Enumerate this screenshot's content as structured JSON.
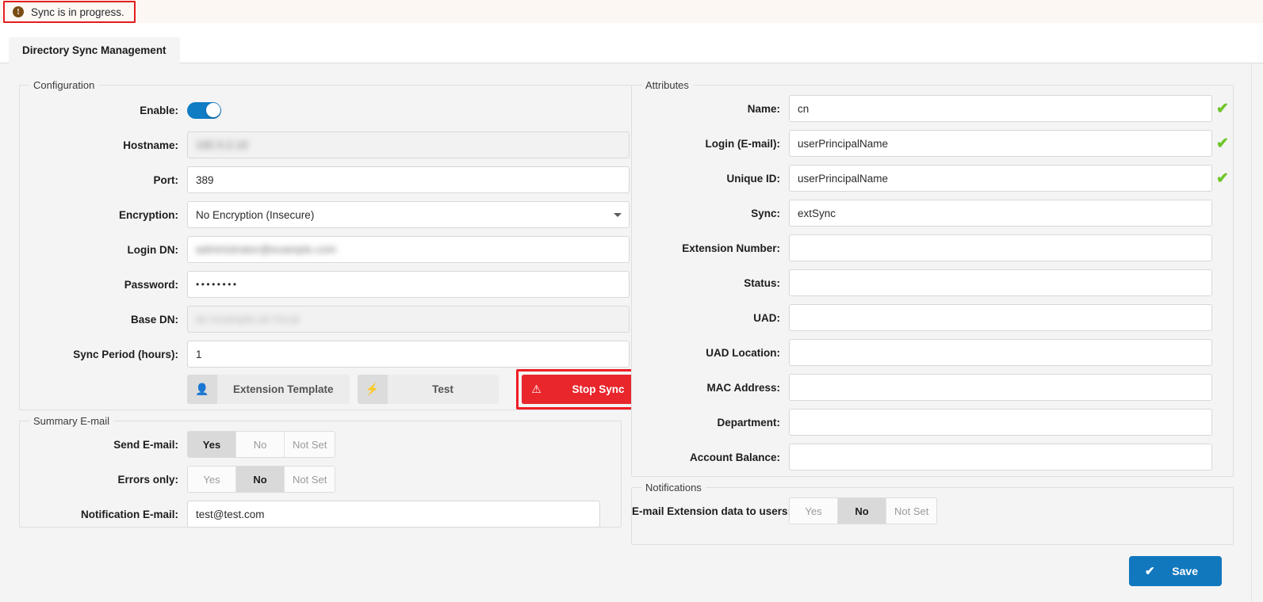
{
  "alert": {
    "icon": "exclamation-circle-icon",
    "message": "Sync is in progress.",
    "border_color": "#e41e1e",
    "background_color": "#fdf8f4"
  },
  "tabs": [
    {
      "label": "Directory Sync Management",
      "active": true
    }
  ],
  "configuration": {
    "legend": "Configuration",
    "rows": [
      {
        "label": "Enable:",
        "type": "toggle",
        "value": "on",
        "check": false
      },
      {
        "label": "Hostname:",
        "type": "text",
        "value": "",
        "redacted": true,
        "disabled": true,
        "check": true
      },
      {
        "label": "Port:",
        "type": "text",
        "value": "389",
        "check": true
      },
      {
        "label": "Encryption:",
        "type": "select",
        "value": "No Encryption (Insecure)",
        "check": true
      },
      {
        "label": "Login DN:",
        "type": "text",
        "value": "",
        "redacted": true,
        "check": true
      },
      {
        "label": "Password:",
        "type": "password",
        "value": "••••••••",
        "check": true
      },
      {
        "label": "Base DN:",
        "type": "text",
        "value": "",
        "redacted": true,
        "disabled": true,
        "check": true
      },
      {
        "label": "Sync Period (hours):",
        "type": "text",
        "value": "1",
        "check": true
      }
    ],
    "encryption_options": [
      "No Encryption (Insecure)"
    ],
    "buttons": [
      {
        "label": "Extension Template",
        "icon": "user-icon",
        "style": "grey",
        "highlighted": false
      },
      {
        "label": "Test",
        "icon": "lightning-icon",
        "style": "grey",
        "highlighted": false
      },
      {
        "label": "Stop Sync",
        "icon": "warning-triangle-icon",
        "style": "red",
        "highlighted": true
      }
    ]
  },
  "summary_email": {
    "legend": "Summary E-mail",
    "rows": [
      {
        "label": "Send E-mail:",
        "type": "segmented",
        "options": [
          "Yes",
          "No",
          "Not Set"
        ],
        "selected": "Yes"
      },
      {
        "label": "Errors only:",
        "type": "segmented",
        "options": [
          "Yes",
          "No",
          "Not Set"
        ],
        "selected": "No"
      },
      {
        "label": "Notification E-mail:",
        "type": "text",
        "value": "test@test.com"
      }
    ]
  },
  "attributes": {
    "legend": "Attributes",
    "rows": [
      {
        "label": "Name:",
        "value": "cn",
        "check": true
      },
      {
        "label": "Login (E-mail):",
        "value": "userPrincipalName",
        "check": true
      },
      {
        "label": "Unique ID:",
        "value": "userPrincipalName",
        "check": true
      },
      {
        "label": "Sync:",
        "value": "extSync",
        "check": false
      },
      {
        "label": "Extension Number:",
        "value": "",
        "check": false
      },
      {
        "label": "Status:",
        "value": "",
        "check": false
      },
      {
        "label": "UAD:",
        "value": "",
        "check": false
      },
      {
        "label": "UAD Location:",
        "value": "",
        "check": false
      },
      {
        "label": "MAC Address:",
        "value": "",
        "check": false
      },
      {
        "label": "Department:",
        "value": "",
        "check": false
      },
      {
        "label": "Account Balance:",
        "value": "",
        "check": false
      }
    ]
  },
  "notifications": {
    "legend": "Notifications",
    "rows": [
      {
        "label": "E-mail Extension data to users:",
        "options": [
          "Yes",
          "No",
          "Not Set"
        ],
        "selected": "No"
      }
    ]
  },
  "footer": {
    "save_label": "Save",
    "save_icon": "check-icon",
    "save_color": "#1278be"
  },
  "icons": {
    "check": "✔",
    "user": "👤",
    "lightning": "⚡",
    "warning": "⚠",
    "alert": "!"
  }
}
